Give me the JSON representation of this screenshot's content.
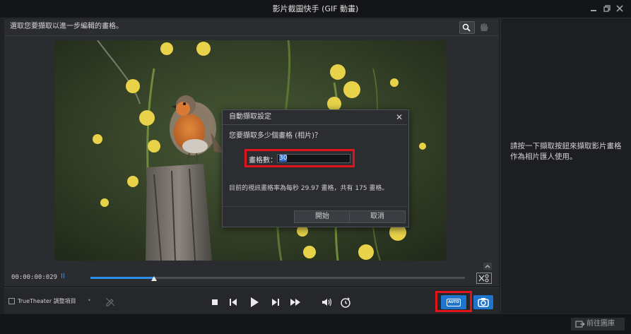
{
  "window": {
    "title": "影片截圖快手 (GIF 動畫)",
    "controls": [
      "minimize-icon",
      "restore-icon",
      "close-icon"
    ]
  },
  "main": {
    "instruction": "選取您要擷取以進一步編輯的畫格。",
    "tools": [
      "zoom-search-icon",
      "hand-pan-icon"
    ]
  },
  "right_panel": {
    "hint": "請按一下擷取按鈕來擷取影片畫格作為相片匯人使用。"
  },
  "dialog": {
    "title": "自動擷取設定",
    "close": "✕",
    "question": "您要擷取多少個畫格 (相片)？",
    "frames_label": "畫格數：",
    "frames_value": "30",
    "info": "目前的視訊畫格率為每秒 29.97 畫格，共有 175 畫格。",
    "start_label": "開始",
    "cancel_label": "取消"
  },
  "timeline": {
    "timecode": "00:00:00:029",
    "pause_mark": "II",
    "progress": 0.17
  },
  "controls": {
    "truetheater_label": "TrueTheater 調整項目",
    "truetheater_checked": false,
    "dot": "•",
    "auto_label": "AUTO"
  },
  "status_bar": {
    "gallery_label": "前往圖庫"
  },
  "colors": {
    "accent": "#1f74cc",
    "highlight_box": "#e0141c",
    "progress": "#2f8fe8"
  }
}
